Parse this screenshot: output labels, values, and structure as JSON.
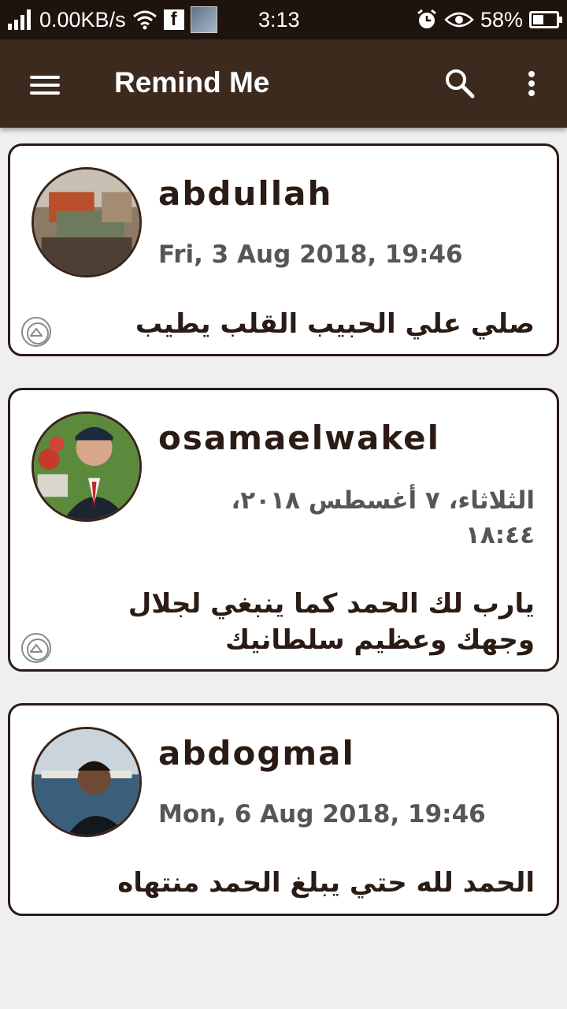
{
  "status_bar": {
    "network_speed": "0.00KB/s",
    "time": "3:13",
    "battery": "58%",
    "icons": [
      "signal-icon",
      "wifi-icon",
      "facebook-icon",
      "notification-thumbnail-icon",
      "alarm-icon",
      "eye-icon",
      "battery-icon"
    ]
  },
  "app_bar": {
    "title": "Remind Me",
    "icons": [
      "menu-icon",
      "search-icon",
      "more-options-icon"
    ]
  },
  "reminders": [
    {
      "name": "abdullah",
      "date": "Fri, 3 Aug 2018, 19:46",
      "message": "صلي علي الحبيب القلب يطيب",
      "date_rtl": false
    },
    {
      "name": "osamaelwakel",
      "date": "الثلاثاء، ٧ أغسطس ٢٠١٨، ١٨:٤٤",
      "message": "يارب لك الحمد كما ينبغي لجلال وجهك وعظيم سلطانيك",
      "date_rtl": true
    },
    {
      "name": "abdogmal",
      "date": "Mon, 6 Aug 2018, 19:46",
      "message": "الحمد لله حتي يبلغ الحمد منتهاه",
      "date_rtl": false
    }
  ],
  "colors": {
    "status_bar": "#1f130d",
    "app_bar": "#3d2a1e",
    "card_border": "#2a1b14",
    "background": "#efefef"
  }
}
